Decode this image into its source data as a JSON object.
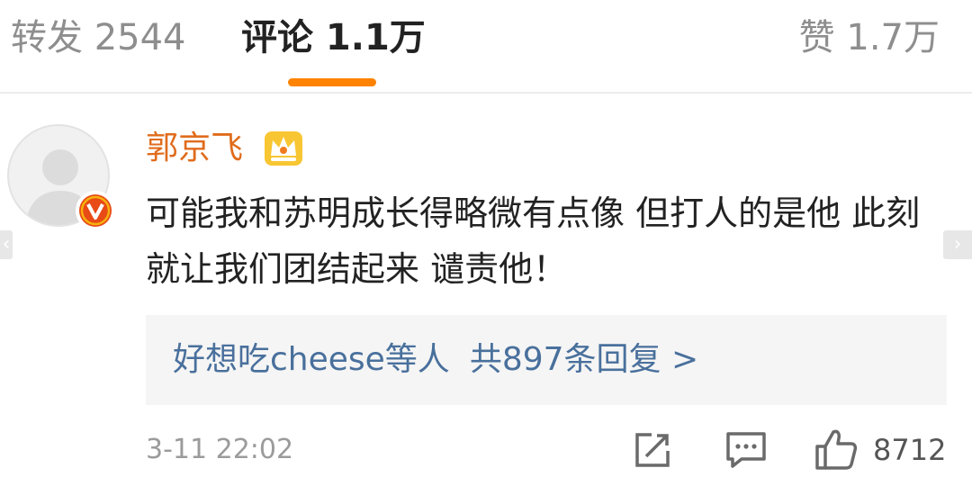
{
  "tabs": {
    "repost": "转发 2544",
    "comments": "评论 1.1万",
    "likes": "赞 1.7万"
  },
  "comment": {
    "username": "郭京飞",
    "text": "可能我和苏明成长得略微有点像 但打人的是他 此刻就让我们团结起来 谴责他！",
    "replies": {
      "users": "好想吃cheese等人",
      "count": "共897条回复 >"
    },
    "timestamp": "3-11 22:02",
    "like_count": "8712"
  },
  "icons": {
    "avatar": "default-avatar",
    "badge": "verified-v-icon",
    "member": "crown-icon",
    "share": "share-icon",
    "reply": "reply-icon",
    "like": "thumbs-up-icon"
  },
  "colors": {
    "accent": "#ff8200",
    "username": "#e06c1c",
    "link": "#49709c",
    "badge": "#e84b16"
  }
}
